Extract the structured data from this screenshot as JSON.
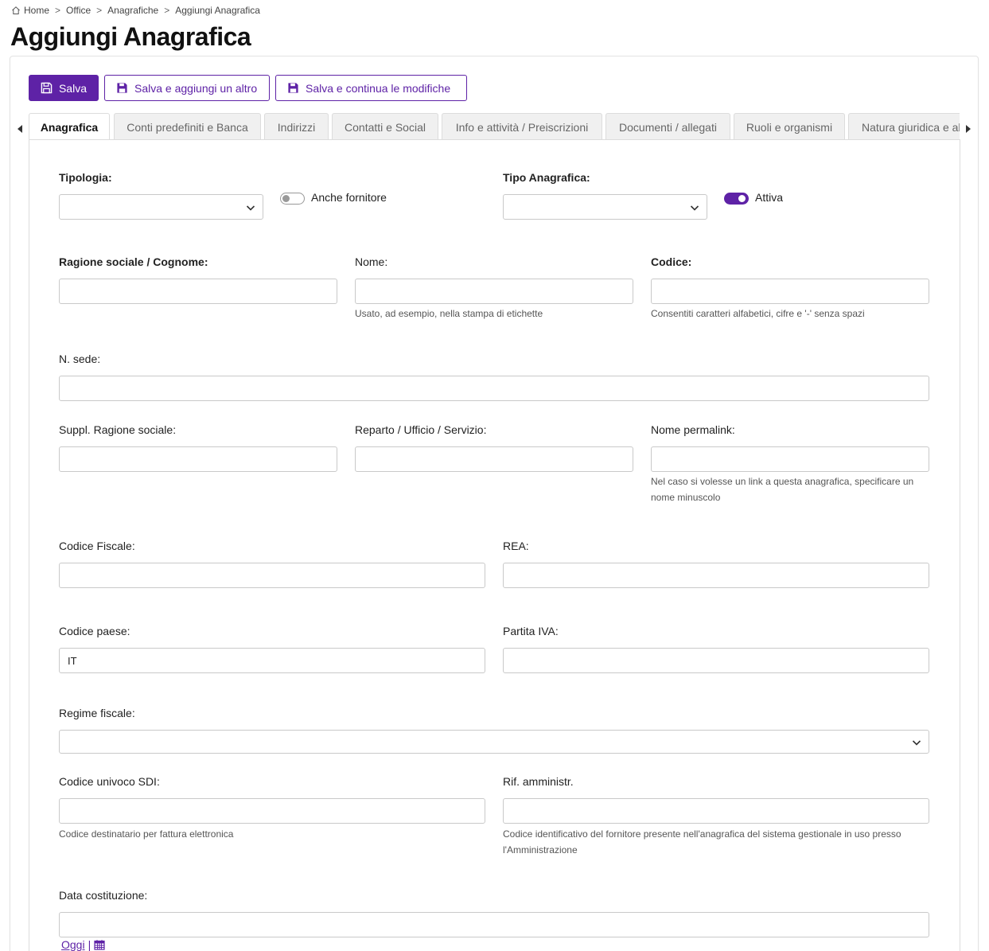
{
  "breadcrumb": {
    "items": [
      "Home",
      "Office",
      "Anagrafiche",
      "Aggiungi Anagrafica"
    ],
    "separator": ">"
  },
  "page": {
    "title": "Aggiungi Anagrafica"
  },
  "toolbar": {
    "save_label": "Salva",
    "save_add_label": "Salva e aggiungi un altro",
    "save_continue_label": "Salva e continua le modifiche"
  },
  "tabs": [
    {
      "label": "Anagrafica",
      "active": true
    },
    {
      "label": "Conti predefiniti e Banca"
    },
    {
      "label": "Indirizzi"
    },
    {
      "label": "Contatti e Social"
    },
    {
      "label": "Info e attività / Preiscrizioni"
    },
    {
      "label": "Documenti / allegati"
    },
    {
      "label": "Ruoli e organismi"
    },
    {
      "label": "Natura giuridica e altro"
    }
  ],
  "form": {
    "tipologia": {
      "label": "Tipologia:",
      "value": ""
    },
    "anche_fornitore": {
      "label": "Anche fornitore",
      "checked": false
    },
    "tipo_anagrafica": {
      "label": "Tipo Anagrafica:",
      "value": ""
    },
    "attiva": {
      "label": "Attiva",
      "checked": true
    },
    "ragione_sociale": {
      "label": "Ragione sociale / Cognome:",
      "value": ""
    },
    "nome": {
      "label": "Nome:",
      "value": "",
      "help": "Usato, ad esempio, nella stampa di etichette"
    },
    "codice": {
      "label": "Codice:",
      "value": "",
      "help": "Consentiti caratteri alfabetici, cifre e '-' senza spazi"
    },
    "n_sede": {
      "label": "N. sede:",
      "value": ""
    },
    "suppl_ragione_sociale": {
      "label": "Suppl. Ragione sociale:",
      "value": ""
    },
    "reparto": {
      "label": "Reparto / Ufficio / Servizio:",
      "value": ""
    },
    "nome_permalink": {
      "label": "Nome permalink:",
      "value": "",
      "help": "Nel caso si volesse un link a questa anagrafica, specificare un nome minuscolo"
    },
    "codice_fiscale": {
      "label": "Codice Fiscale:",
      "value": ""
    },
    "rea": {
      "label": "REA:",
      "value": ""
    },
    "codice_paese": {
      "label": "Codice paese:",
      "value": "IT"
    },
    "partita_iva": {
      "label": "Partita IVA:",
      "value": ""
    },
    "regime_fiscale": {
      "label": "Regime fiscale:",
      "value": ""
    },
    "codice_sdi": {
      "label": "Codice univoco SDI:",
      "value": "",
      "help": "Codice destinatario per fattura elettronica"
    },
    "rif_amministr": {
      "label": "Rif. amministr.",
      "value": "",
      "help": "Codice identificativo del fornitore presente nell'anagrafica del sistema gestionale in uso presso l'Amministrazione"
    },
    "data_costituzione": {
      "label": "Data costituzione:",
      "value": "",
      "today_label": "Oggi",
      "divider": "|"
    }
  },
  "colors": {
    "accent": "#5e22a6",
    "border": "#c9c9c9",
    "tab_bg": "#f0f0f0"
  },
  "icons": {
    "home": "home-icon",
    "save": "floppy-disk-icon",
    "chevron": "chevron-down-icon",
    "calendar": "calendar-icon"
  }
}
